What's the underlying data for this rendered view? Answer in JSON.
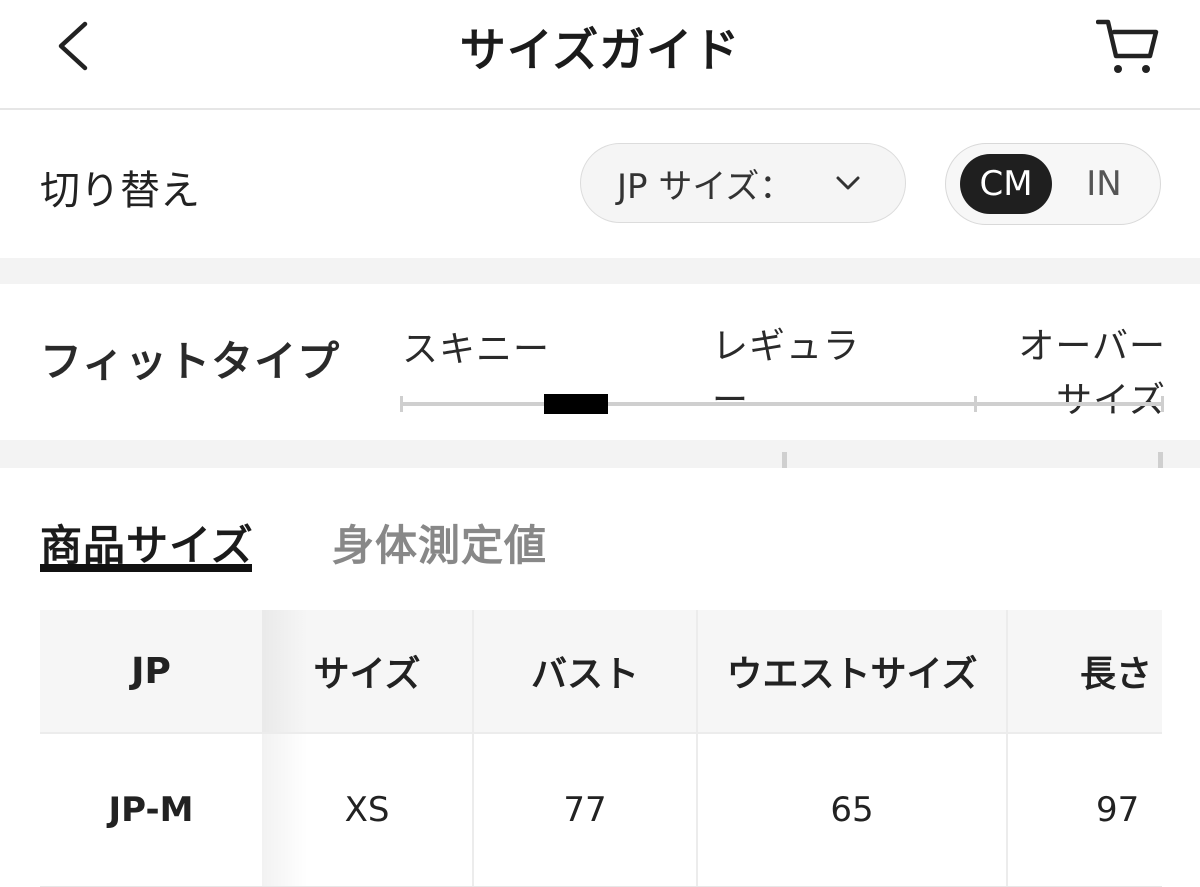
{
  "header": {
    "title": "サイズガイド"
  },
  "switch_row": {
    "label": "切り替え",
    "size_system": "JP サイズ：",
    "units": [
      "CM",
      "IN"
    ],
    "selected_unit": "CM"
  },
  "fit_type": {
    "label": "フィットタイプ",
    "option_1": "スキニー",
    "option_2": "レギュラー",
    "option_3": "オーバーサイズ",
    "marker_position": 0.23
  },
  "tabs": {
    "product_size": "商品サイズ",
    "body_measurements": "身体測定値",
    "active": "商品サイズ"
  },
  "size_table": {
    "headers": [
      "JP",
      "サイズ",
      "バスト",
      "ウエストサイズ",
      "長さ"
    ],
    "rows": [
      [
        "JP-M",
        "XS",
        "77",
        "65",
        "97"
      ]
    ]
  }
}
